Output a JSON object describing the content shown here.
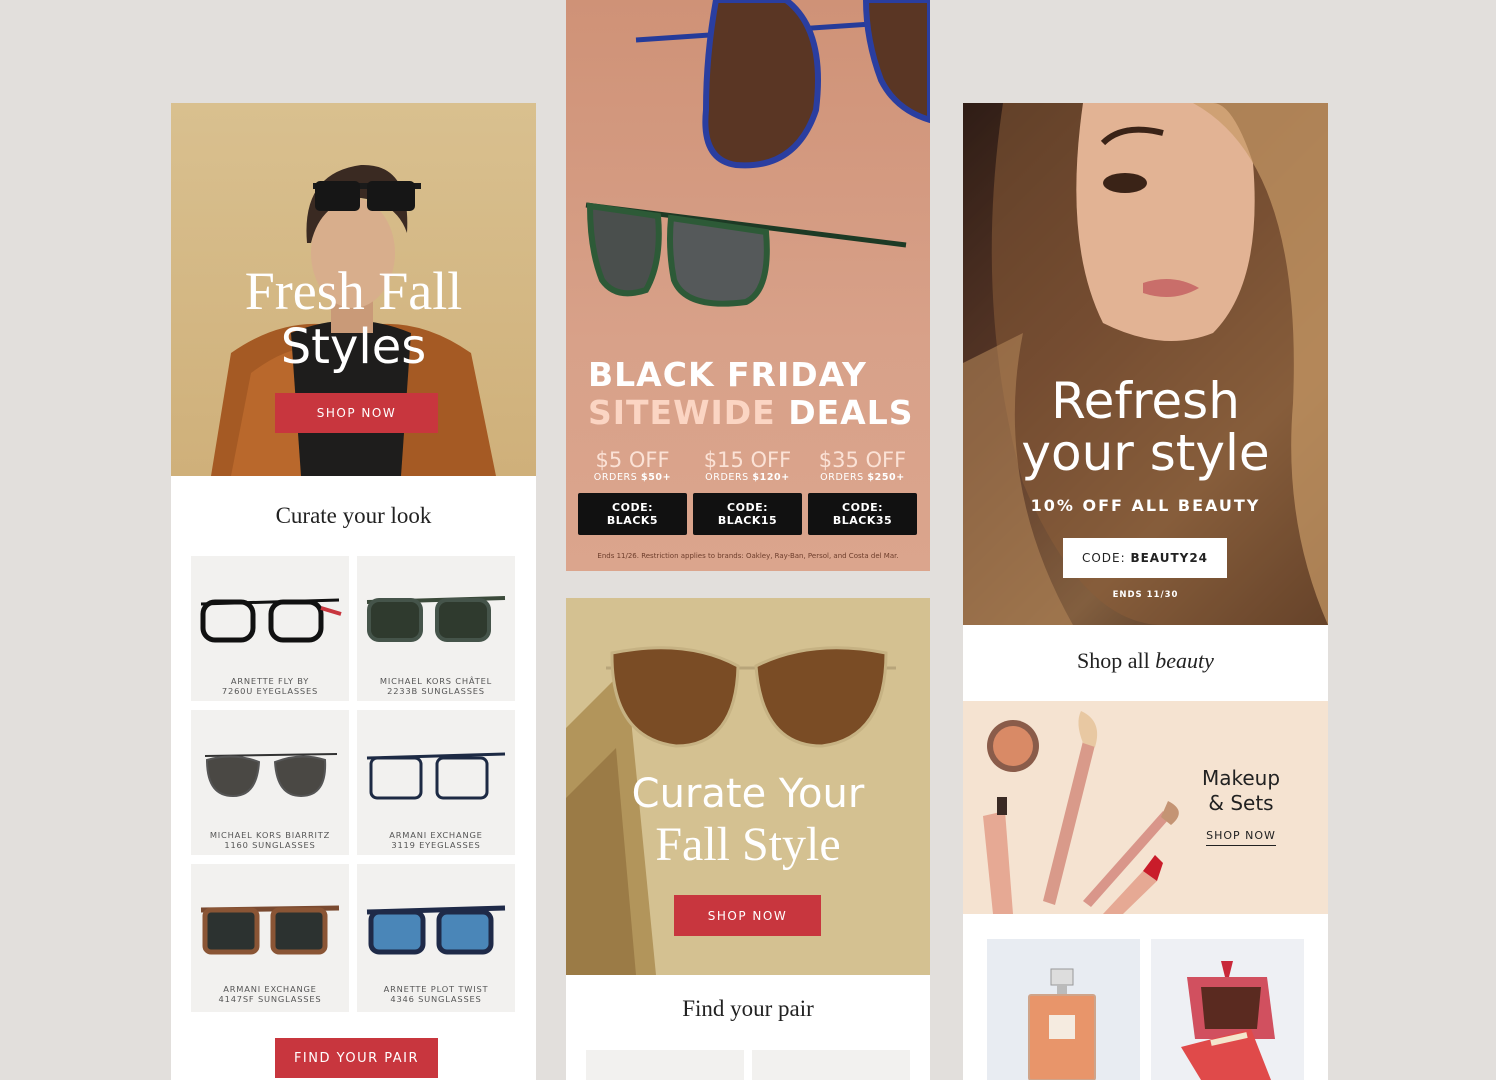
{
  "colors": {
    "page_bg": "#e2dfdc",
    "accent_red": "#c8363e",
    "promo_pink": "#d49a81",
    "beige": "#d4c191",
    "beauty_peach": "#f5e3d1"
  },
  "left_email": {
    "hero": {
      "title_line1": "Fresh Fall",
      "title_line2": "Styles",
      "cta": "SHOP NOW"
    },
    "section_title": "Curate your look",
    "products": [
      {
        "line1": "ARNETTE FLY BY",
        "line2": "7260U EYEGLASSES",
        "icon": "eyeglasses-icon"
      },
      {
        "line1": "MICHAEL KORS CHÂTEL",
        "line2": "2233B SUNGLASSES",
        "icon": "sunglasses-icon"
      },
      {
        "line1": "MICHAEL KORS BIARRITZ",
        "line2": "1160 SUNGLASSES",
        "icon": "aviator-sunglasses-icon"
      },
      {
        "line1": "ARMANI EXCHANGE",
        "line2": "3119 EYEGLASSES",
        "icon": "eyeglasses-icon"
      },
      {
        "line1": "ARMANI EXCHANGE",
        "line2": "4147SF SUNGLASSES",
        "icon": "sunglasses-icon"
      },
      {
        "line1": "ARNETTE PLOT TWIST",
        "line2": "4346 SUNGLASSES",
        "icon": "sunglasses-icon"
      }
    ],
    "cta": "FIND YOUR PAIR"
  },
  "center_promo": {
    "headline_line1": "BLACK FRIDAY",
    "headline_sitewide": "SITEWIDE",
    "headline_deals": "DEALS",
    "offers": [
      {
        "off": "$5 OFF",
        "orders_prefix": "ORDERS ",
        "orders_amount": "$50+",
        "code_label": "CODE:",
        "code": "BLACK5"
      },
      {
        "off": "$15 OFF",
        "orders_prefix": "ORDERS ",
        "orders_amount": "$120+",
        "code_label": "CODE:",
        "code": "BLACK15"
      },
      {
        "off": "$35 OFF",
        "orders_prefix": "ORDERS ",
        "orders_amount": "$250+",
        "code_label": "CODE:",
        "code": "BLACK35"
      }
    ],
    "fine_print": "Ends 11/26. Restriction applies to brands: Oakley, Ray-Ban, Persol, and Costa del Mar."
  },
  "center_email": {
    "hero": {
      "title_line1": "Curate Your",
      "title_line2": "Fall Style",
      "cta": "SHOP NOW"
    },
    "section_title": "Find your pair"
  },
  "right_email": {
    "hero": {
      "title_line1": "Refresh",
      "title_line2": "your style",
      "subtitle": "10% OFF ALL BEAUTY",
      "code_label": "CODE: ",
      "code": "BEAUTY24",
      "ends": "ENDS 11/30"
    },
    "section_title_plain": "Shop all ",
    "section_title_italic": "beauty",
    "category": {
      "title_line1": "Makeup",
      "title_line2": "& Sets",
      "cta": "SHOP NOW"
    }
  }
}
